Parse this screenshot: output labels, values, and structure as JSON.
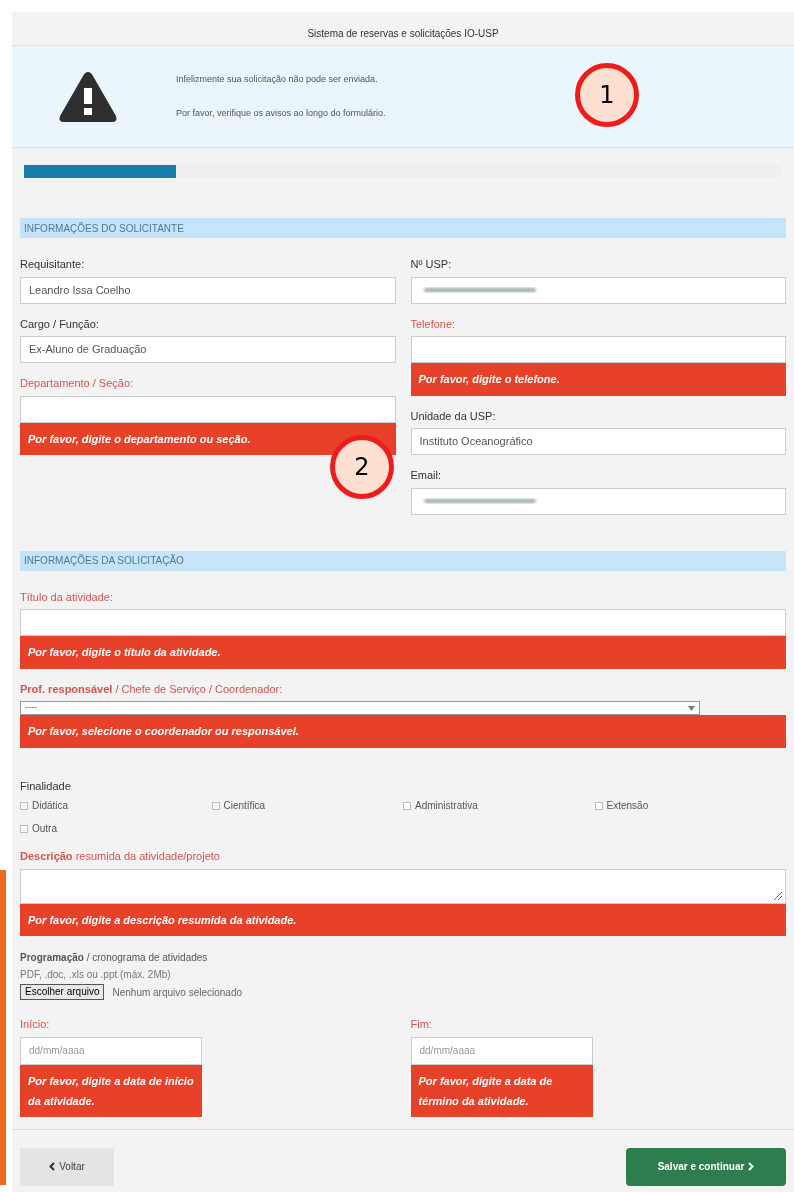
{
  "title": "Sistema de reservas e solicitações IO-USP",
  "alert": {
    "lines": [
      "Infelizmente sua solicitação não pode ser enviada.",
      "Por favor, verifique os avisos ao longo do formulário."
    ]
  },
  "progress": {
    "level": 0.2
  },
  "section_1": {
    "heading": "INFORMAÇÕES DO SOLICITANTE",
    "left_column": [
      {
        "kind": "text",
        "label": "Requisitante:",
        "value": "Leandro Issa Coelho",
        "invalid": false
      },
      {
        "kind": "text",
        "label": "Cargo / Função:",
        "value": "Ex-Aluno de Graduação",
        "invalid": false
      },
      {
        "kind": "text",
        "label": "Departamento / Seção:",
        "invalid": true,
        "error": "Por favor, digite o departamento ou seção."
      }
    ],
    "right_column": [
      {
        "kind": "redacted",
        "label": "Nº USP:",
        "invalid": false
      },
      {
        "kind": "text",
        "label": "Telefone:",
        "invalid": true,
        "error": "Por favor, digite o telefone."
      },
      {
        "kind": "text",
        "label": "Unidade da USP:",
        "value": "Instituto Oceanográfico",
        "invalid": false
      },
      {
        "kind": "redacted",
        "label": "Email:",
        "invalid": false
      }
    ]
  },
  "section_2": {
    "heading": "INFORMAÇÕES DA SOLICITAÇÃO",
    "fields": [
      {
        "kind": "text",
        "label": "Título da atividade:",
        "invalid": true,
        "error": "Por favor, digite o título da atividade."
      },
      {
        "kind": "select",
        "label": "**Prof. responsável** / Chefe de Serviço / Coordenador:",
        "value": "----",
        "invalid": true,
        "error": "Por favor, selecione o coordenador ou responsável."
      }
    ],
    "purpose": {
      "label": "Finalidade",
      "options": [
        {
          "label": "Didática",
          "checked": false
        },
        {
          "label": "Científica",
          "checked": false
        },
        {
          "label": "Administrativa",
          "checked": false
        },
        {
          "label": "Extensão",
          "checked": false
        },
        {
          "label": "Outra",
          "checked": false
        }
      ]
    },
    "description": {
      "label": "**Descrição** resumida da atividade/projeto",
      "invalid": true,
      "error": "Por favor, digite a descrição resumida da atividade."
    },
    "schedule": {
      "label": "**Programação** / cronograma de atividades",
      "hint": "PDF, .doc, .xls ou .ppt (máx. 2Mb)",
      "button": "Escolher arquivo",
      "status": "Nenhum arquivo selecionado"
    },
    "dates": [
      {
        "label": "Início:",
        "placeholder": "dd/mm/aaaa",
        "invalid": true,
        "error": "Por favor, digite a data de início da atividade."
      },
      {
        "label": "Fim:",
        "placeholder": "dd/mm/aaaa",
        "invalid": true,
        "error": "Por favor, digite a data de término da atividade."
      }
    ]
  },
  "buttons": {
    "back": "Voltar",
    "next": "Salvar e continuar"
  },
  "callouts": [
    "1",
    "2"
  ]
}
